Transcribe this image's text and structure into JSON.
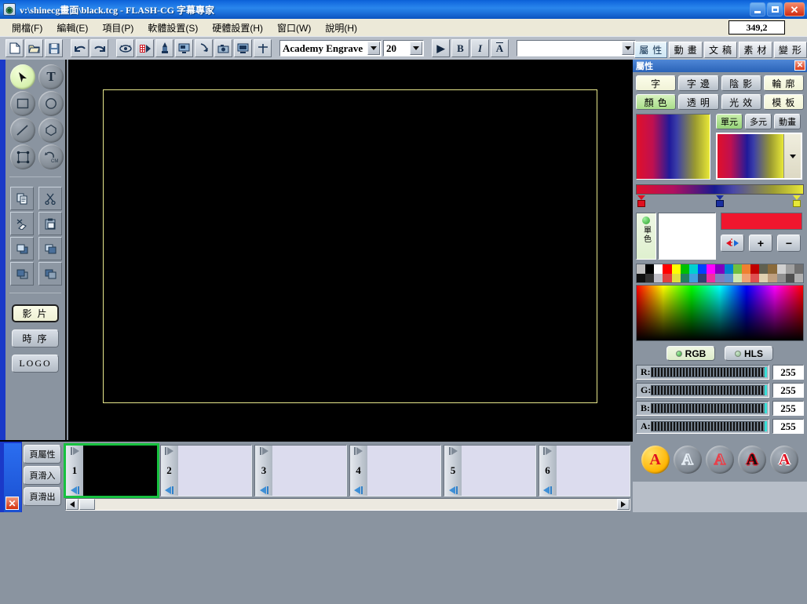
{
  "window": {
    "title": "v:\\shinecg畫面\\black.tcg  -  FLASH-CG  字幕專家",
    "icon": "app-globe-icon",
    "minimize": "_",
    "maximize": "□",
    "close": "✕"
  },
  "menubar": {
    "items": [
      {
        "label": "開檔(F)"
      },
      {
        "label": "編輯(E)"
      },
      {
        "label": "項目(P)"
      },
      {
        "label": "軟體設置(S)"
      },
      {
        "label": "硬體設置(H)"
      },
      {
        "label": "窗口(W)"
      },
      {
        "label": "說明(H)"
      }
    ],
    "coordinate": "349,2"
  },
  "toolbar": {
    "buttons": [
      {
        "name": "new-file-icon",
        "glyph": "page"
      },
      {
        "name": "open-folder-icon",
        "glyph": "folder"
      },
      {
        "name": "save-disk-icon",
        "glyph": "disk"
      },
      {
        "name": "undo-icon",
        "glyph": "undo"
      },
      {
        "name": "redo-icon",
        "glyph": "redo"
      },
      {
        "name": "preview-eye-icon",
        "glyph": "eye"
      },
      {
        "name": "play-film-icon",
        "glyph": "film"
      },
      {
        "name": "paint-icon",
        "glyph": "paint"
      },
      {
        "name": "monitor-out-icon",
        "glyph": "monitor"
      },
      {
        "name": "import-icon",
        "glyph": "import"
      },
      {
        "name": "camera-icon",
        "glyph": "camera"
      },
      {
        "name": "display-icon",
        "glyph": "display"
      },
      {
        "name": "crosshair-icon",
        "glyph": "cross"
      }
    ],
    "font_name": "Academy Engrave",
    "font_size": "20",
    "play_label": "▶",
    "bold_label": "B",
    "italic_label": "I",
    "underline_label": "A",
    "text_combo_value": ""
  },
  "panel_tabs": [
    {
      "label": "屬 性",
      "active": true
    },
    {
      "label": "動 畫",
      "active": false
    },
    {
      "label": "文 稿",
      "active": false
    },
    {
      "label": "素 材",
      "active": false
    },
    {
      "label": "變 形",
      "active": false
    }
  ],
  "tools": {
    "round_tools": [
      {
        "name": "arrow-select-tool",
        "glyph": "arrow",
        "selected": true
      },
      {
        "name": "text-tool",
        "glyph": "T",
        "selected": false
      },
      {
        "name": "rectangle-tool",
        "glyph": "square",
        "selected": false
      },
      {
        "name": "ellipse-tool",
        "glyph": "circle",
        "selected": false
      },
      {
        "name": "line-tool",
        "glyph": "line",
        "selected": false
      },
      {
        "name": "polygon-tool",
        "glyph": "polygon",
        "selected": false
      },
      {
        "name": "transform-tool",
        "glyph": "nodes",
        "selected": false
      },
      {
        "name": "rotate-cm-tool",
        "glyph": "rotcm",
        "selected": false
      }
    ],
    "edit_tools": [
      {
        "name": "copy-icon",
        "glyph": "copy"
      },
      {
        "name": "cut-scissors-icon",
        "glyph": "scissors"
      },
      {
        "name": "erase-icon",
        "glyph": "erase"
      },
      {
        "name": "paste-icon",
        "glyph": "paste"
      },
      {
        "name": "send-backward-icon",
        "glyph": "back1"
      },
      {
        "name": "bring-forward-icon",
        "glyph": "fwd1"
      },
      {
        "name": "send-to-back-icon",
        "glyph": "back2"
      },
      {
        "name": "bring-to-front-icon",
        "glyph": "fwd2"
      }
    ],
    "mode_buttons": [
      {
        "label": "影 片",
        "active": true
      },
      {
        "label": "時 序",
        "active": false
      },
      {
        "label": "LOGO",
        "active": false
      }
    ]
  },
  "page_panel": {
    "buttons": [
      {
        "label": "頁屬性"
      },
      {
        "label": "頁滑入"
      },
      {
        "label": "頁滑出"
      }
    ],
    "close_label": "✕"
  },
  "thumbnails": [
    {
      "number": "1",
      "selected": true,
      "black": true
    },
    {
      "number": "2",
      "selected": false,
      "black": false
    },
    {
      "number": "3",
      "selected": false,
      "black": false
    },
    {
      "number": "4",
      "selected": false,
      "black": false
    },
    {
      "number": "5",
      "selected": false,
      "black": false
    },
    {
      "number": "6",
      "selected": false,
      "black": false
    }
  ],
  "properties": {
    "title": "屬性",
    "close_label": "✕",
    "tabs_row1": [
      {
        "label": "字",
        "active": true
      },
      {
        "label": "字 邊",
        "active": false
      },
      {
        "label": "陰 影",
        "active": false
      },
      {
        "label": "輪 廓",
        "active": false
      }
    ],
    "tabs_row2": [
      {
        "label": "顏 色",
        "active": true,
        "style": "green"
      },
      {
        "label": "透 明",
        "active": false
      },
      {
        "label": "光 效",
        "active": false
      },
      {
        "label": "模 板",
        "active": false
      }
    ],
    "fill_modes": [
      {
        "label": "單元",
        "active": true
      },
      {
        "label": "多元",
        "active": false
      },
      {
        "label": "動畫",
        "active": false
      }
    ],
    "single_color_label": "單色",
    "current_color": "#f0162e",
    "color_buttons": [
      {
        "name": "mirror-gradient-button",
        "label": "◀▶"
      },
      {
        "name": "add-stop-button",
        "label": "+"
      },
      {
        "name": "remove-stop-button",
        "label": "−"
      }
    ],
    "gradient_stops": [
      {
        "color": "#e01020",
        "position": 0
      },
      {
        "color": "#1a2fa0",
        "position": 50
      },
      {
        "color": "#e8e838",
        "position": 100
      }
    ],
    "color_mode": [
      {
        "label": "RGB",
        "active": true
      },
      {
        "label": "HLS",
        "active": false
      }
    ],
    "channels": [
      {
        "label": "R:",
        "value": "255"
      },
      {
        "label": "G:",
        "value": "255"
      },
      {
        "label": "B:",
        "value": "255"
      },
      {
        "label": "A:",
        "value": "255"
      }
    ],
    "palette_row1": [
      "#c0c0c0",
      "#000000",
      "#ffffff",
      "#ff0000",
      "#ffff00",
      "#00c000",
      "#00d0d0",
      "#0040ff",
      "#ff00ff",
      "#8000c0",
      "#0080d0",
      "#70c040",
      "#f08030",
      "#c00000",
      "#606050",
      "#8a6a3a",
      "#d0d0d0",
      "#a0a0a0",
      "#707070"
    ],
    "palette_row2": [
      "#101010",
      "#303030",
      "#c0c0c8",
      "#e04040",
      "#e0e040",
      "#208060",
      "#40a0e0",
      "#304070",
      "#f030a0",
      "#8080c0",
      "#6090d0",
      "#d0e8b0",
      "#f0a070",
      "#e05050",
      "#e0d0b0",
      "#c0a080",
      "#909090",
      "#505050",
      "#b0b0b0"
    ]
  },
  "style_buttons": [
    {
      "name": "style-solid-gold",
      "variant": "gold",
      "label": "A"
    },
    {
      "name": "style-hollow-white",
      "variant": "hollow",
      "label": "A"
    },
    {
      "name": "style-outline-red",
      "variant": "outline-red",
      "label": "A"
    },
    {
      "name": "style-black-red-edge",
      "variant": "black-red",
      "label": "A"
    },
    {
      "name": "style-red-white-edge",
      "variant": "red-white",
      "label": "A"
    }
  ]
}
